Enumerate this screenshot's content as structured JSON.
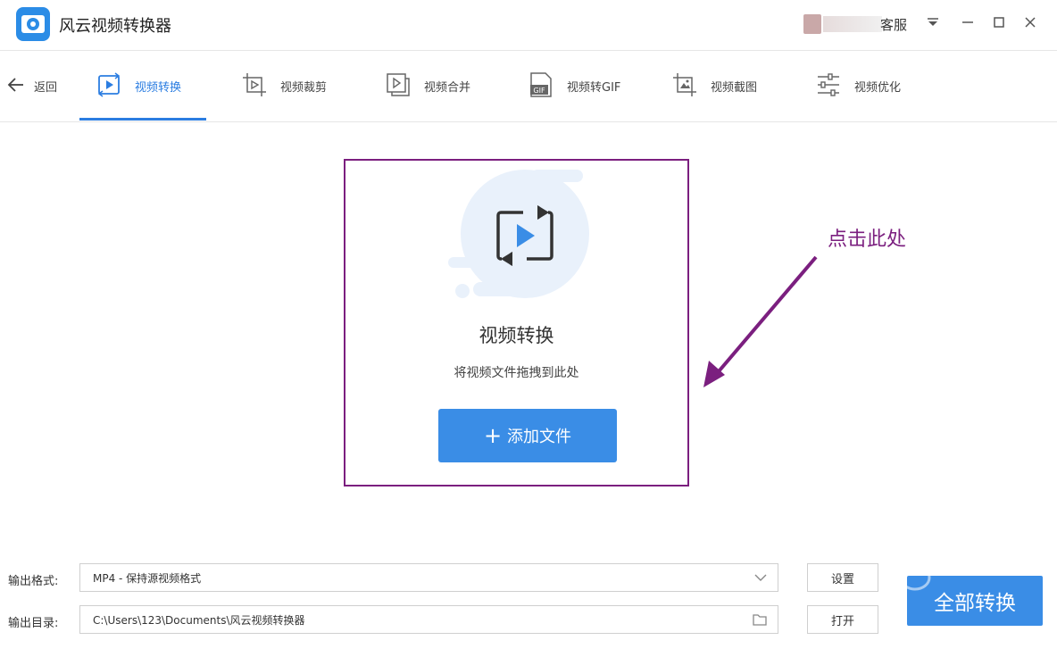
{
  "app": {
    "title": "风云视频转换器",
    "service_label": "客服"
  },
  "toolbar": {
    "back_label": "返回",
    "tools": [
      {
        "label": "视频转换",
        "icon": "convert-icon",
        "active": true
      },
      {
        "label": "视频裁剪",
        "icon": "crop-icon"
      },
      {
        "label": "视频合并",
        "icon": "merge-icon"
      },
      {
        "label": "视频转GIF",
        "icon": "gif-icon"
      },
      {
        "label": "视频截图",
        "icon": "screenshot-icon"
      },
      {
        "label": "视频优化",
        "icon": "sliders-icon"
      }
    ]
  },
  "drop_area": {
    "title": "视频转换",
    "hint": "将视频文件拖拽到此处",
    "add_button_label": "添加文件",
    "add_button_icon": "plus-icon"
  },
  "annotation": {
    "text": "点击此处",
    "color": "#7b1f7f"
  },
  "output": {
    "format_label": "输出格式:",
    "format_value": "MP4 - 保持源视频格式",
    "dir_label": "输出目录:",
    "dir_value": "C:\\Users\\123\\Documents\\风云视频转换器",
    "settings_button": "设置",
    "open_button": "打开",
    "convert_all_button": "全部转换"
  },
  "colors": {
    "accent": "#2b7de1",
    "button": "#3a8de6",
    "highlight_border": "#7b1f7f"
  }
}
